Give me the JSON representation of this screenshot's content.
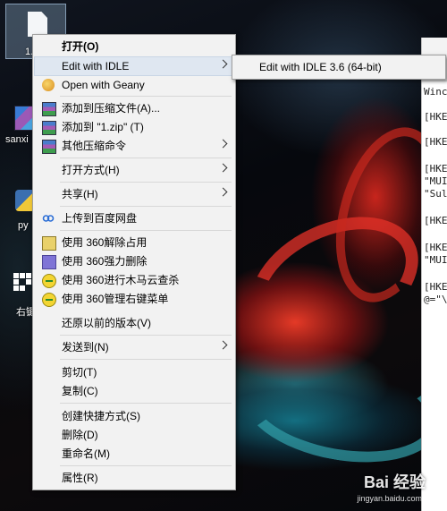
{
  "desktop": {
    "icons": [
      {
        "label": "1.",
        "icon": "file-icon"
      },
      {
        "label": "sanxi",
        "icon": "winrar-icon"
      },
      {
        "label": "py",
        "icon": "python-icon"
      },
      {
        "label": "右键",
        "icon": "shortcut-icon"
      }
    ]
  },
  "notepad": {
    "lines": [
      "Winc",
      "[HKE",
      "[HKE",
      "[HKE",
      "\"MUI",
      "\"Sul",
      "[HKE",
      "[HKE",
      "\"MUI",
      "[HKE",
      "@=\"\\"
    ]
  },
  "context_menu": {
    "items": [
      {
        "label": "打开(O)",
        "bold": true
      },
      {
        "label": "Edit with IDLE",
        "submenu": true,
        "highlighted": true
      },
      {
        "label": "Open with Geany",
        "icon": "geany-icon"
      },
      {
        "label": "添加到压缩文件(A)...",
        "icon": "winrar-icon"
      },
      {
        "label": "添加到 \"1.zip\" (T)",
        "icon": "winrar-icon"
      },
      {
        "label": "其他压缩命令",
        "icon": "winrar-icon",
        "submenu": true
      },
      {
        "label": "打开方式(H)",
        "submenu": true
      },
      {
        "label": "共享(H)",
        "submenu": true
      },
      {
        "label": "上传到百度网盘",
        "icon": "baidu-cloud-icon"
      },
      {
        "label": "使用 360解除占用",
        "icon": "360-unlock-icon"
      },
      {
        "label": "使用 360强力删除",
        "icon": "360-shred-icon"
      },
      {
        "label": "使用 360进行木马云查杀",
        "icon": "360-scan-icon"
      },
      {
        "label": "使用 360管理右键菜单",
        "icon": "360-menu-icon"
      },
      {
        "label": "还原以前的版本(V)"
      },
      {
        "label": "发送到(N)",
        "submenu": true
      },
      {
        "label": "剪切(T)"
      },
      {
        "label": "复制(C)"
      },
      {
        "label": "创建快捷方式(S)"
      },
      {
        "label": "删除(D)"
      },
      {
        "label": "重命名(M)"
      },
      {
        "label": "属性(R)"
      }
    ]
  },
  "submenu": {
    "items": [
      {
        "label": "Edit with IDLE 3.6 (64-bit)"
      }
    ]
  },
  "watermark": {
    "brand": "Bai 经验",
    "url": "jingyan.baidu.com"
  }
}
